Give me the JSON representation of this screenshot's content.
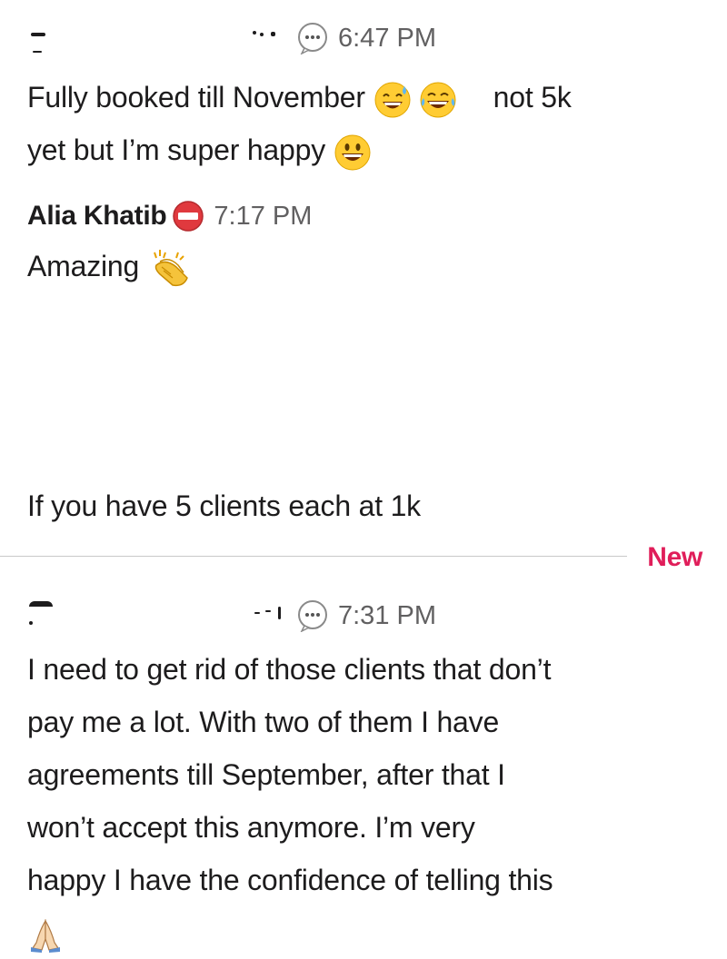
{
  "messages": [
    {
      "time": "6:47 PM",
      "text_a": "Fully booked till November",
      "text_b": "not 5k",
      "text_c": "yet but I’m super happy"
    },
    {
      "author": "Alia Khatib",
      "time": "7:17 PM",
      "text": "Amazing"
    },
    {
      "text": "If you have 5 clients each at 1k"
    },
    {
      "time": "7:31 PM",
      "lines": [
        "I need to get rid of those clients that don’t",
        "pay me a lot. With two of them I have",
        "agreements till September, after that I",
        "won’t accept this anymore. I’m very",
        "happy I have the confidence of telling this"
      ]
    }
  ],
  "divider": {
    "label": "New",
    "color": "#e01e5a"
  },
  "icons": {
    "status_1": "speech-bubble-icon",
    "status_2": "no-entry-icon",
    "status_3": "speech-bubble-icon"
  },
  "emojis": [
    "sweat-smile-emoji",
    "joy-emoji",
    "grinning-emoji",
    "clapping-hands-emoji",
    "folded-hands-emoji"
  ]
}
